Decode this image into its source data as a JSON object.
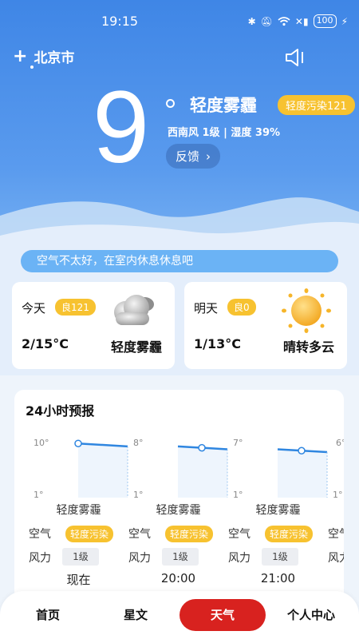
{
  "status_bar": {
    "time": "19:15",
    "battery": "100"
  },
  "header": {
    "add_icon": "plus-icon",
    "city": "北京市",
    "speaker_icon": "speaker-icon"
  },
  "current": {
    "temperature": "9",
    "condition": "轻度雾霾",
    "aqi_badge": "轻度污染121",
    "wind_humidity": "西南风 1级 | 湿度 39%",
    "feedback_label": "反馈",
    "feedback_chevron": "›"
  },
  "tip": "空气不太好，在室内休息休息吧",
  "today": {
    "label": "今天",
    "aqi": "良121",
    "range": "2/15°C",
    "condition": "轻度雾霾",
    "icon": "cloud-haze-icon"
  },
  "tomorrow": {
    "label": "明天",
    "aqi": "良0",
    "range": "1/13°C",
    "condition": "晴转多云",
    "icon": "sun-icon"
  },
  "forecast": {
    "title": "24小时预报",
    "columns": [
      {
        "top_tick": "10°",
        "bottom_tick": "1°",
        "condition": "轻度雾霾",
        "air_label": "空气",
        "air": "轻度污染",
        "wind_label": "风力",
        "wind": "1级",
        "time": "现在"
      },
      {
        "top_tick": "8°",
        "bottom_tick": "1°",
        "condition": "轻度雾霾",
        "air_label": "空气",
        "air": "轻度污染",
        "wind_label": "风力",
        "wind": "1级",
        "time": "20:00"
      },
      {
        "top_tick": "7°",
        "bottom_tick": "1°",
        "condition": "轻度雾霾",
        "air_label": "空气",
        "air": "轻度污染",
        "wind_label": "风力",
        "wind": "1级",
        "time": "21:00"
      },
      {
        "top_tick": "6°",
        "bottom_tick": "1°",
        "air_label": "空气",
        "wind_label": "风力"
      }
    ]
  },
  "chart_data": {
    "type": "line",
    "x": [
      "现在",
      "20:00",
      "21:00"
    ],
    "series": [
      {
        "values": [
          9,
          8.5,
          8
        ]
      }
    ]
  },
  "nav": {
    "items": [
      "首页",
      "星文",
      "天气",
      "个人中心"
    ],
    "active": "天气"
  },
  "colors": {
    "accent": "#d8221f",
    "badge": "#f7c230",
    "sky": "#3f86e6",
    "line": "#2f86e0"
  }
}
